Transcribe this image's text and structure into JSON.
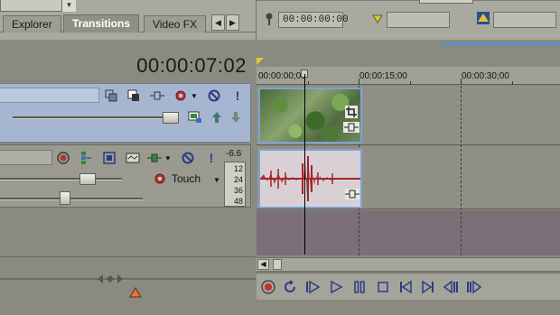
{
  "top": {
    "dropdown_value": "",
    "tabs": [
      {
        "label": "Explorer"
      },
      {
        "label": "Transitions"
      },
      {
        "label": "Video FX"
      }
    ],
    "timecode_in": "00:00:00:00",
    "timecode_out": ""
  },
  "left": {
    "current_time": "00:00:07:02",
    "video_track": {
      "name": ""
    },
    "audio_track": {
      "name": "",
      "automation_mode": "Touch",
      "meter_peak": "-6.6",
      "meter_scale": [
        "12",
        "24",
        "36",
        "48"
      ]
    }
  },
  "timeline": {
    "ruler_labels": [
      "00:00:00;00",
      "00:00:15;00",
      "00:00:30;00"
    ]
  },
  "colors": {
    "video_track": "#a7b6d0",
    "clip_border": "#7ea2d6",
    "waveform": "#a3262d",
    "record_red": "#c03030",
    "empty_lane": "#7b6f78"
  }
}
